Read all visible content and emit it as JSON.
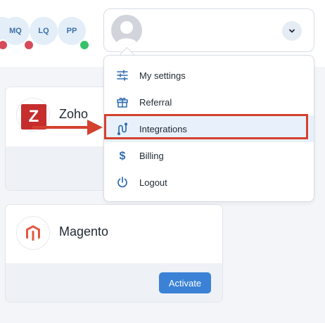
{
  "users": [
    {
      "initials": "MQ",
      "status": "red"
    },
    {
      "initials": "LQ",
      "status": "red"
    },
    {
      "initials": "PP",
      "status": "green"
    }
  ],
  "profile_menu": {
    "items": [
      {
        "label": "My settings",
        "icon": "sliders-icon"
      },
      {
        "label": "Referral",
        "icon": "gift-icon"
      },
      {
        "label": "Integrations",
        "icon": "integrations-icon",
        "active": true
      },
      {
        "label": "Billing",
        "icon": "dollar-icon"
      },
      {
        "label": "Logout",
        "icon": "power-icon"
      }
    ]
  },
  "integrations": [
    {
      "name": "Zoho",
      "logo_text": "Z",
      "logo_color": "#c62d2d"
    },
    {
      "name": "Magento",
      "action_label": "Activate",
      "logo_color": "#e2583e"
    }
  ],
  "colors": {
    "accent": "#3b82d6",
    "highlight": "#d4412f",
    "icon": "#2f6db0"
  }
}
